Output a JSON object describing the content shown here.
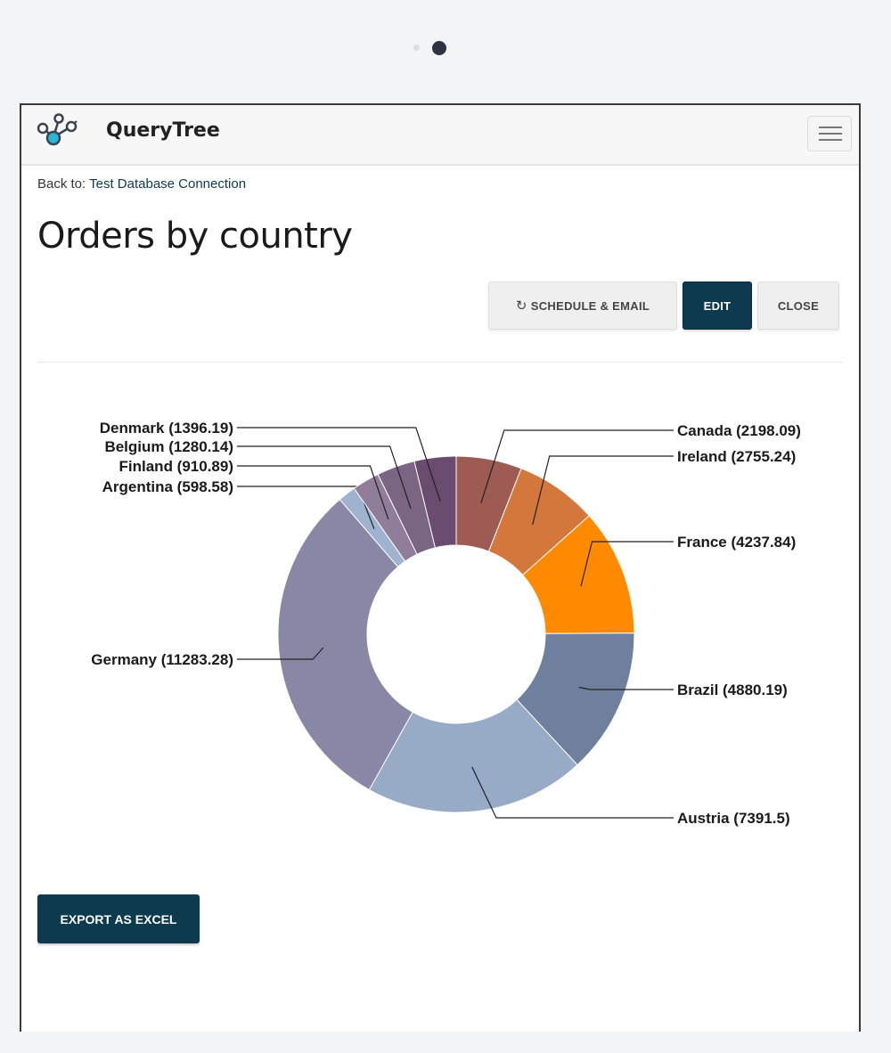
{
  "app": {
    "title": "QueryTree"
  },
  "breadcrumb": {
    "prefix": "Back to:",
    "link": "Test Database Connection"
  },
  "page": {
    "title": "Orders by country"
  },
  "actions": {
    "schedule": "SCHEDULE & EMAIL",
    "edit": "EDIT",
    "close": "CLOSE"
  },
  "export": {
    "label": "EXPORT AS EXCEL"
  },
  "icons": {
    "logo": "molecule-logo-icon",
    "menu": "hamburger-menu-icon",
    "schedule": "refresh-icon"
  },
  "colors": {
    "primary": "#0e3a50"
  },
  "chart_data": {
    "type": "pie",
    "donut": true,
    "labels": [
      "Canada",
      "Ireland",
      "France",
      "Brazil",
      "Austria",
      "Germany",
      "Argentina",
      "Finland",
      "Belgium",
      "Denmark"
    ],
    "values": [
      2198.09,
      2755.24,
      4237.84,
      4880.19,
      7391.5,
      11283.28,
      598.58,
      910.89,
      1280.14,
      1396.19
    ],
    "data_labels": [
      "Canada (2198.09)",
      "Ireland (2755.24)",
      "France (4237.84)",
      "Brazil (4880.19)",
      "Austria (7391.5)",
      "Germany (11283.28)",
      "Argentina (598.58)",
      "Finland (910.89)",
      "Belgium (1280.14)",
      "Denmark (1396.19)"
    ],
    "colors": [
      "#9e5b54",
      "#d4773c",
      "#ff8a00",
      "#6e809e",
      "#98abc6",
      "#8888a6",
      "#9fb3d0",
      "#8f7d9a",
      "#7a6582",
      "#6a4c6e"
    ]
  }
}
